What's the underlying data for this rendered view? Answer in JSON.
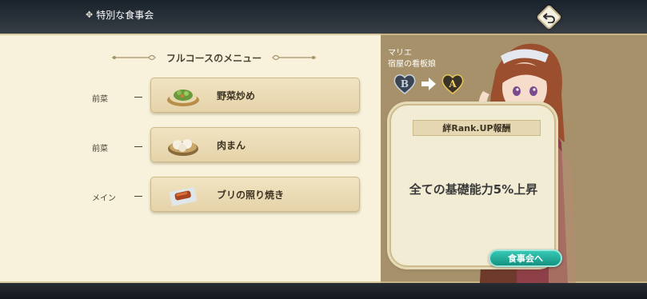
{
  "header": {
    "title": "特別な食事会",
    "emblem_icon": "crest-icon",
    "back_icon": "return-arrow-icon"
  },
  "menu": {
    "heading": "フルコースのメニュー",
    "courses": [
      {
        "course_label": "前菜",
        "dash": "ー",
        "dish_name": "野菜炒め",
        "icon": "stir-fry-dish-icon"
      },
      {
        "course_label": "前菜",
        "dash": "ー",
        "dish_name": "肉まん",
        "icon": "steamed-bun-dish-icon"
      },
      {
        "course_label": "メイン",
        "dash": "ー",
        "dish_name": "ブリの照り焼き",
        "icon": "teriyaki-fish-dish-icon"
      }
    ]
  },
  "character": {
    "name": "マリエ",
    "role": "宿屋の看板娘",
    "rank_from": "B",
    "rank_to": "A"
  },
  "reward": {
    "title": "絆Rank.UP報酬",
    "text": "全ての基礎能力5%上昇"
  },
  "actions": {
    "meal_button": "食事会へ"
  },
  "colors": {
    "menu_bg": "#f8f2dc",
    "char_bg": "#a6916a",
    "button_teal": "#1fa895",
    "text_dark": "#3e3424"
  }
}
